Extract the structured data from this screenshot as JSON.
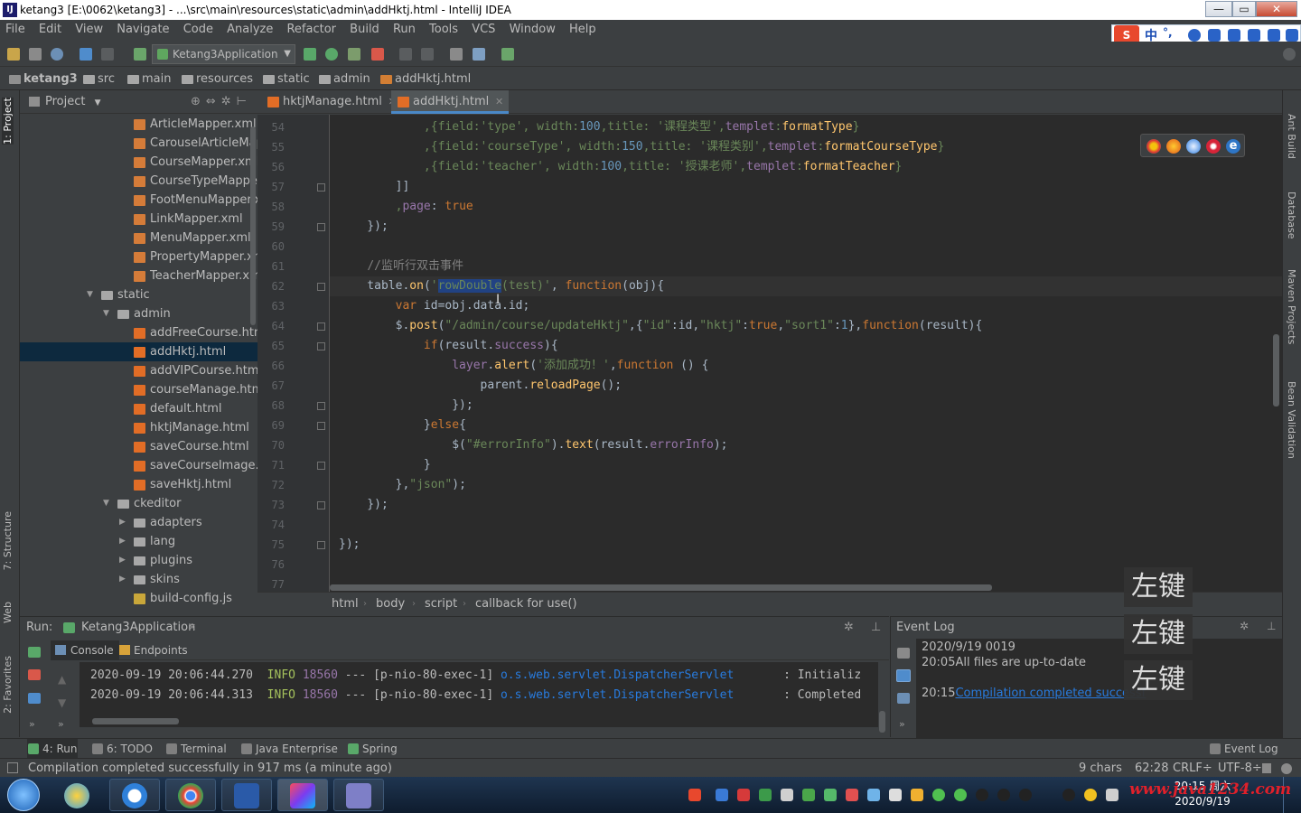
{
  "window": {
    "title": "ketang3 [E:\\0062\\ketang3] - ...\\src\\main\\resources\\static\\admin\\addHktj.html - IntelliJ IDEA",
    "app_icon": "IJ",
    "controls": [
      "—",
      "▭",
      "✕"
    ]
  },
  "menu": [
    "File",
    "Edit",
    "View",
    "Navigate",
    "Code",
    "Analyze",
    "Refactor",
    "Build",
    "Run",
    "Tools",
    "VCS",
    "Window",
    "Help"
  ],
  "ime": {
    "mode": "中",
    "logo": "S",
    "punct": "°,"
  },
  "toolbar": {
    "run_config": "Ketang3Application"
  },
  "breadcrumbs": [
    "ketang3",
    "src",
    "main",
    "resources",
    "static",
    "admin",
    "addHktj.html"
  ],
  "left_strip": {
    "project": "1: Project",
    "structure": "7: Structure",
    "web": "Web",
    "favorites": "2: Favorites"
  },
  "right_strip": {
    "ant": "Ant Build",
    "database": "Database",
    "maven": "Maven Projects",
    "bean": "Bean Validation"
  },
  "project_panel": {
    "title": "Project",
    "tree": [
      {
        "label": "ArticleMapper.xml",
        "type": "xml",
        "depth": 7
      },
      {
        "label": "CarouselArticleMapper",
        "type": "xml",
        "depth": 7
      },
      {
        "label": "CourseMapper.xml",
        "type": "xml",
        "depth": 7
      },
      {
        "label": "CourseTypeMapper",
        "type": "xml",
        "depth": 7
      },
      {
        "label": "FootMenuMapper.x",
        "type": "xml",
        "depth": 7
      },
      {
        "label": "LinkMapper.xml",
        "type": "xml",
        "depth": 7
      },
      {
        "label": "MenuMapper.xml",
        "type": "xml",
        "depth": 7
      },
      {
        "label": "PropertyMapper.xm",
        "type": "xml",
        "depth": 7
      },
      {
        "label": "TeacherMapper.xml",
        "type": "xml",
        "depth": 7
      },
      {
        "label": "static",
        "type": "folder",
        "depth": 5,
        "expanded": true
      },
      {
        "label": "admin",
        "type": "folder",
        "depth": 6,
        "expanded": true
      },
      {
        "label": "addFreeCourse.htm",
        "type": "html",
        "depth": 7
      },
      {
        "label": "addHktj.html",
        "type": "html",
        "depth": 7,
        "selected": true
      },
      {
        "label": "addVIPCourse.html",
        "type": "html",
        "depth": 7
      },
      {
        "label": "courseManage.html",
        "type": "html",
        "depth": 7
      },
      {
        "label": "default.html",
        "type": "html",
        "depth": 7
      },
      {
        "label": "hktjManage.html",
        "type": "html",
        "depth": 7
      },
      {
        "label": "saveCourse.html",
        "type": "html",
        "depth": 7
      },
      {
        "label": "saveCourseImage.h",
        "type": "html",
        "depth": 7
      },
      {
        "label": "saveHktj.html",
        "type": "html",
        "depth": 7
      },
      {
        "label": "ckeditor",
        "type": "folder",
        "depth": 6,
        "expanded": true
      },
      {
        "label": "adapters",
        "type": "folder",
        "depth": 7,
        "expanded": false
      },
      {
        "label": "lang",
        "type": "folder",
        "depth": 7,
        "expanded": false
      },
      {
        "label": "plugins",
        "type": "folder",
        "depth": 7,
        "expanded": false
      },
      {
        "label": "skins",
        "type": "folder",
        "depth": 7,
        "expanded": false
      },
      {
        "label": "build-config.js",
        "type": "js",
        "depth": 7
      }
    ]
  },
  "editor": {
    "tabs": [
      {
        "label": "hktjManage.html",
        "active": false
      },
      {
        "label": "addHktj.html",
        "active": true
      }
    ],
    "lines": [
      {
        "n": "54",
        "html": "            <span class=\"c-str\">,{field:'type', width:</span><span class=\"c-num\">100</span><span class=\"c-str\">,title: '课程类型',</span><span class=\"c-prop\">templet</span><span class=\"c-str\">:</span><span class=\"c-fn\">formatType</span><span class=\"c-str\">}</span>"
      },
      {
        "n": "55",
        "html": "            <span class=\"c-str\">,{field:'courseType', width:</span><span class=\"c-num\">150</span><span class=\"c-str\">,title: '课程类别',</span><span class=\"c-prop\">templet</span><span class=\"c-str\">:</span><span class=\"c-fn\">formatCourseType</span><span class=\"c-str\">}</span>"
      },
      {
        "n": "56",
        "html": "            <span class=\"c-str\">,{field:'teacher', width:</span><span class=\"c-num\">100</span><span class=\"c-str\">,title: '授课老师',</span><span class=\"c-prop\">templet</span><span class=\"c-str\">:</span><span class=\"c-fn\">formatTeacher</span><span class=\"c-str\">}</span>"
      },
      {
        "n": "57",
        "html": "        ]]"
      },
      {
        "n": "58",
        "html": "        <span class=\"c-str\">,</span><span class=\"c-prop\">page</span>: <span class=\"c-kw\">true</span>"
      },
      {
        "n": "59",
        "html": "    });"
      },
      {
        "n": "60",
        "html": ""
      },
      {
        "n": "61",
        "html": "    <span class=\"c-com\">//监听行双击事件</span>"
      },
      {
        "n": "62",
        "html": "    table.<span class=\"c-fn\">on</span>(<span class=\"c-str\">'</span><span class=\"c-sel\">rowDouble</span><span class=\"c-str\">(test)'</span>, <span class=\"c-kw\">function</span>(obj){"
      },
      {
        "n": "63",
        "html": "        <span class=\"c-kw\">var</span> id=obj.data.id;"
      },
      {
        "n": "64",
        "html": "        $.<span class=\"c-fn\">post</span>(<span class=\"c-str\">\"/admin/course/updateHktj\"</span>,{<span class=\"c-str\">\"id\"</span>:id,<span class=\"c-str\">\"hktj\"</span>:<span class=\"c-kw\">true</span>,<span class=\"c-str\">\"sort1\"</span>:<span class=\"c-num\">1</span>},<span class=\"c-kw\">function</span>(result){"
      },
      {
        "n": "65",
        "html": "            <span class=\"c-kw\">if</span>(result.<span class=\"c-prop\">success</span>){"
      },
      {
        "n": "66",
        "html": "                <span class=\"c-prop\">layer</span>.<span class=\"c-fn\">alert</span>(<span class=\"c-str\">'添加成功！'</span>,<span class=\"c-kw\">function</span> () {"
      },
      {
        "n": "67",
        "html": "                    parent.<span class=\"c-fn\">reloadPage</span>();"
      },
      {
        "n": "68",
        "html": "                });"
      },
      {
        "n": "69",
        "html": "            }<span class=\"c-kw\">else</span>{"
      },
      {
        "n": "70",
        "html": "                $(<span class=\"c-str\">\"#errorInfo\"</span>).<span class=\"c-fn\">text</span>(result.<span class=\"c-prop\">errorInfo</span>);"
      },
      {
        "n": "71",
        "html": "            }"
      },
      {
        "n": "72",
        "html": "        },<span class=\"c-str\">\"json\"</span>);"
      },
      {
        "n": "73",
        "html": "    });"
      },
      {
        "n": "74",
        "html": ""
      },
      {
        "n": "75",
        "html": "});"
      },
      {
        "n": "76",
        "html": ""
      },
      {
        "n": "77",
        "html": ""
      }
    ],
    "code_breadcrumbs": [
      "html",
      "body",
      "script",
      "callback for use()"
    ]
  },
  "run_panel": {
    "label": "Run:",
    "app": "Ketang3Application",
    "subtabs": [
      "Console",
      "Endpoints"
    ],
    "log": [
      {
        "ts": "2020-09-19 20:06:44.270",
        "level": "INFO",
        "pid": "18560",
        "sep": "---",
        "thread": "[p-nio-80-exec-1]",
        "cls": "o.s.web.servlet.DispatcherServlet",
        "msg": ": Initializ"
      },
      {
        "ts": "2020-09-19 20:06:44.313",
        "level": "INFO",
        "pid": "18560",
        "sep": "---",
        "thread": "[p-nio-80-exec-1]",
        "cls": "o.s.web.servlet.DispatcherServlet",
        "msg": ": Completed"
      }
    ]
  },
  "event_log": {
    "title": "Event Log",
    "date": "2020/9/19 0019",
    "entries": [
      {
        "time": "20:05",
        "text": "All files are up-to-date",
        "link": ""
      },
      {
        "time": "20:15",
        "text": "",
        "link": "Compilation completed successf"
      }
    ]
  },
  "overlay_keys": [
    "左键",
    "左键",
    "左键"
  ],
  "bottom_tabs": [
    {
      "label": "4: Run",
      "kind": "run",
      "active": true
    },
    {
      "label": "6: TODO",
      "kind": "todo"
    },
    {
      "label": "Terminal",
      "kind": "terminal"
    },
    {
      "label": "Java Enterprise",
      "kind": "java"
    },
    {
      "label": "Spring",
      "kind": "spring"
    }
  ],
  "bottom_right": {
    "event_log": "Event Log"
  },
  "status": {
    "message": "Compilation completed successfully in 917 ms (a minute ago)",
    "chars": "9 chars",
    "position": "62:28",
    "line_sep": "CRLF÷",
    "encoding": "UTF-8÷"
  },
  "taskbar": {
    "clock_time": "20:15 周六",
    "clock_date": "2020/9/19",
    "watermark": "www.java1234.com"
  }
}
